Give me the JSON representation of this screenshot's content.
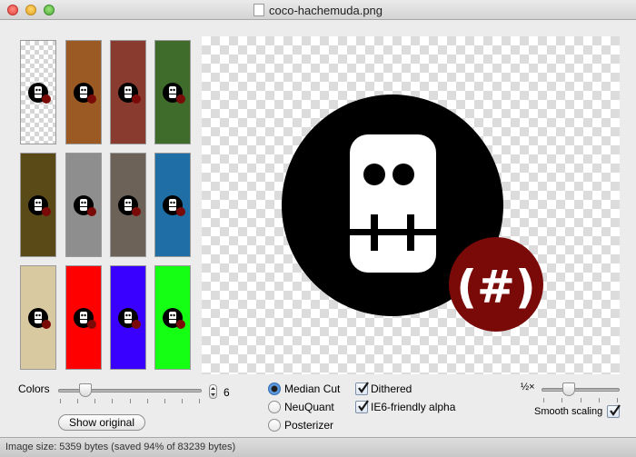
{
  "window": {
    "title": "coco-hachemuda.png"
  },
  "thumbnails": [
    {
      "name": "transparent",
      "background": "checker"
    },
    {
      "name": "rust",
      "background": "#9b5a24"
    },
    {
      "name": "bricks",
      "background": "#8a3b30"
    },
    {
      "name": "leaves",
      "background": "#3f6b2b"
    },
    {
      "name": "moss",
      "background": "#5a4a18"
    },
    {
      "name": "metal-spikes",
      "background": "#8e8e8e"
    },
    {
      "name": "stones",
      "background": "#6c6258"
    },
    {
      "name": "water",
      "background": "#1f6fa6"
    },
    {
      "name": "parchment",
      "background": "#d9c9a1"
    },
    {
      "name": "red",
      "background": "#ff0000"
    },
    {
      "name": "blue",
      "background": "#3a00ff"
    },
    {
      "name": "green",
      "background": "#14ff14"
    }
  ],
  "controls": {
    "colors_label": "Colors",
    "colors_value": "6",
    "colors_level": 0.19,
    "show_original": "Show original",
    "algorithms": [
      {
        "label": "Median Cut",
        "selected": true
      },
      {
        "label": "NeuQuant",
        "selected": false
      },
      {
        "label": "Posterizer",
        "selected": false
      }
    ],
    "options": [
      {
        "label": "Dithered",
        "checked": true
      },
      {
        "label": "IE6-friendly alpha",
        "checked": true
      }
    ],
    "zoom_label": "½×",
    "zoom_level": 0.35,
    "smooth_scaling_label": "Smooth scaling",
    "smooth_scaling_checked": true
  },
  "status": {
    "text": "Image size: 5359 bytes (saved 94% of 83239 bytes)"
  },
  "colors": {
    "logo_black": "#000000",
    "logo_white": "#ffffff",
    "badge_red": "#7a0a08"
  }
}
